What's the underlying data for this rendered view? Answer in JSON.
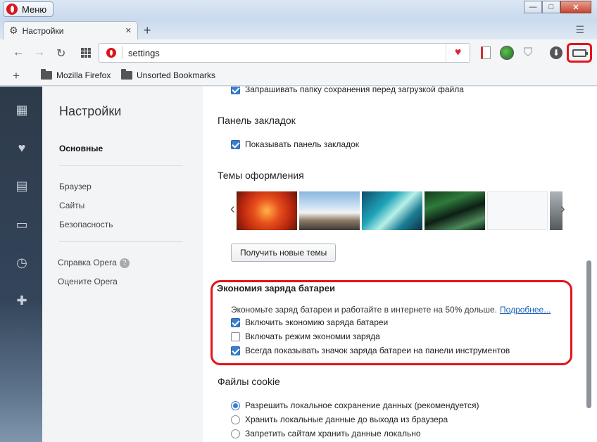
{
  "titlebar": {
    "menu_label": "Меню",
    "min": "—",
    "max": "□",
    "close": "✕"
  },
  "tab": {
    "title": "Настройки",
    "close": "✕"
  },
  "toolbar": {
    "url": "settings"
  },
  "bookmarks": [
    {
      "label": "Mozilla Firefox"
    },
    {
      "label": "Unsorted Bookmarks"
    }
  ],
  "sidebar": {
    "title": "Настройки",
    "items": [
      {
        "label": "Основные",
        "active": true
      },
      {
        "label": "Браузер"
      },
      {
        "label": "Сайты"
      },
      {
        "label": "Безопасность"
      }
    ],
    "help": "Справка Opera",
    "rate": "Оцените Opera"
  },
  "main": {
    "top_checkbox": {
      "label": "Запрашивать папку сохранения перед загрузкой файла",
      "checked": true
    },
    "bookmarks_panel": {
      "title": "Панель закладок",
      "show_label": "Показывать панель закладок",
      "checked": true
    },
    "themes": {
      "title": "Темы оформления",
      "get_new": "Получить новые темы"
    },
    "battery": {
      "title": "Экономия заряда батареи",
      "desc": "Экономьте заряд батареи и работайте в интернете на 50% дольше.",
      "more": "Подробнее...",
      "options": [
        {
          "label": "Включить экономию заряда батареи",
          "checked": true
        },
        {
          "label": "Включать режим экономии заряда",
          "checked": false
        },
        {
          "label": "Всегда показывать значок заряда батареи на панели инструментов",
          "checked": true
        }
      ]
    },
    "cookies": {
      "title": "Файлы cookie",
      "options": [
        {
          "label": "Разрешить локальное сохранение данных (рекомендуется)",
          "selected": true
        },
        {
          "label": "Хранить локальные данные до выхода из браузера",
          "selected": false
        },
        {
          "label": "Запретить сайтам хранить данные локально",
          "selected": false
        }
      ]
    }
  },
  "colors": {
    "accent": "#3b7fd0",
    "highlight": "#e4141b",
    "opera_red": "#d9161c",
    "rail": "#2d3a4a"
  }
}
